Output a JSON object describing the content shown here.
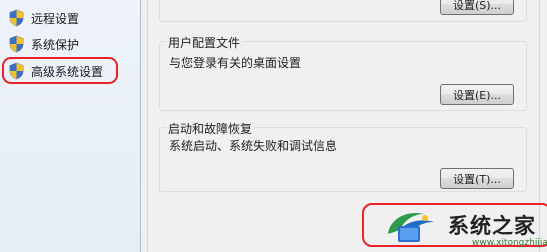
{
  "sidebar": {
    "items": [
      {
        "label": "远程设置",
        "icon": "shield-icon"
      },
      {
        "label": "系统保护",
        "icon": "shield-icon"
      },
      {
        "label": "高级系统设置",
        "icon": "shield-icon",
        "highlighted": true
      }
    ]
  },
  "main": {
    "top_group": {
      "button_label": "设置(S)..."
    },
    "profile_group": {
      "title": "用户配置文件",
      "description": "与您登录有关的桌面设置",
      "button_label": "设置(E)..."
    },
    "startup_group": {
      "title": "启动和故障恢复",
      "description": "系统启动、系统失败和调试信息",
      "button_label": "设置(T)..."
    }
  },
  "watermark": {
    "brand": "系统之家",
    "url": "www.xitongzhijia.net",
    "highlight_color": "#e8232a"
  }
}
